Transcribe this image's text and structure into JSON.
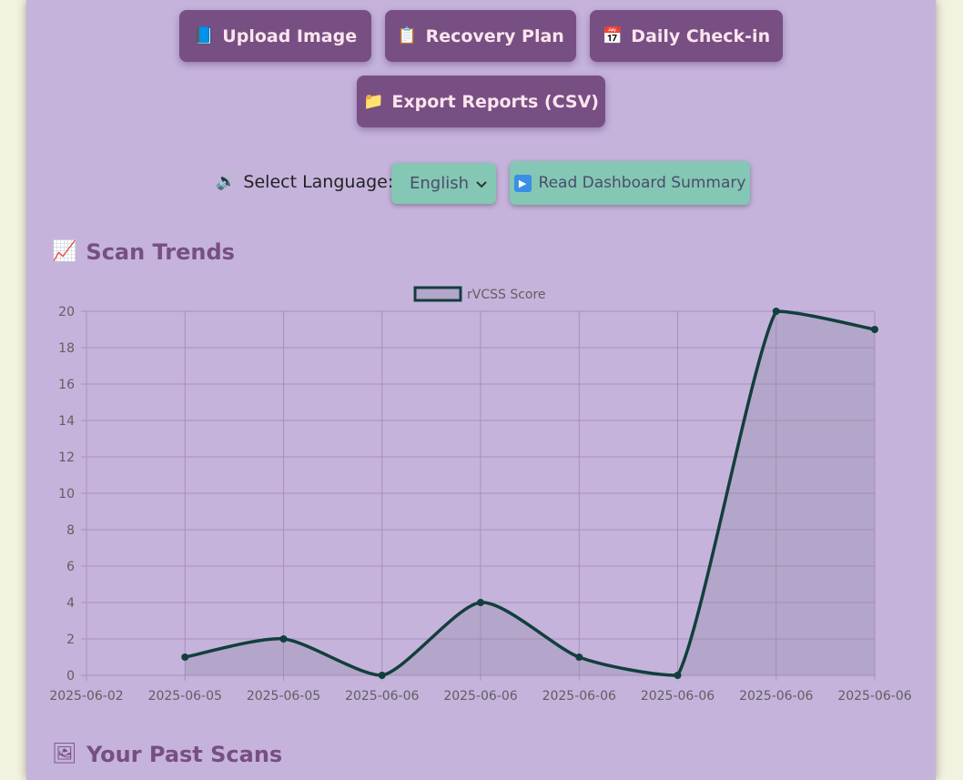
{
  "buttons": {
    "upload": {
      "label": "Upload Image",
      "icon": "📘"
    },
    "recovery": {
      "label": "Recovery Plan",
      "icon": "📋"
    },
    "checkin": {
      "label": "Daily Check-in",
      "icon": "📅"
    },
    "export": {
      "label": "Export Reports (CSV)",
      "icon": "📁"
    }
  },
  "language": {
    "label": "Select Language:",
    "icon": "🔊",
    "selected": "English",
    "read_label": "Read Dashboard Summary",
    "read_icon": "▶"
  },
  "sections": {
    "trends": {
      "title": "Scan Trends",
      "icon": "📈"
    },
    "past": {
      "title": "Your Past Scans",
      "icon": "🖼"
    }
  },
  "colors": {
    "accent": "#774f83",
    "panel": "#c5b3dc",
    "teal": "#84c7b4",
    "line": "#123f3c"
  },
  "chart_data": {
    "type": "area",
    "x": [
      "2025-06-02",
      "2025-06-05",
      "2025-06-05",
      "2025-06-06",
      "2025-06-06",
      "2025-06-06",
      "2025-06-06",
      "2025-06-06",
      "2025-06-06"
    ],
    "series": [
      {
        "name": "rVCSS Score",
        "values": [
          null,
          1,
          2,
          0,
          4,
          1,
          0,
          20,
          19
        ]
      }
    ],
    "ylim": [
      0,
      20
    ],
    "yticks": [
      0,
      2,
      4,
      6,
      8,
      10,
      12,
      14,
      16,
      18,
      20
    ],
    "grid": true,
    "legend": "top"
  }
}
